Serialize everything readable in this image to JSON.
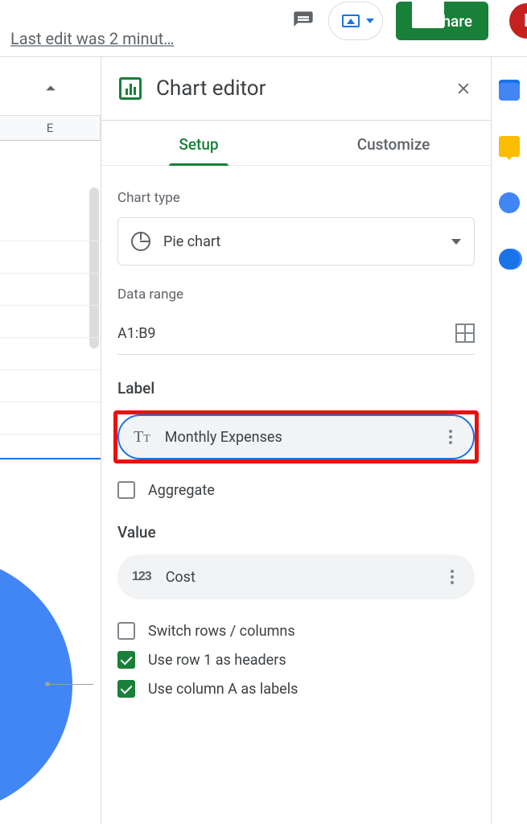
{
  "topbar": {
    "last_edit": "Last edit was 2 minut…",
    "share_label": "Share",
    "avatar_initial": "D"
  },
  "sheet": {
    "column_header": "E"
  },
  "panel": {
    "title": "Chart editor",
    "tabs": {
      "setup": "Setup",
      "customize": "Customize"
    },
    "chart_type_label": "Chart type",
    "chart_type_value": "Pie chart",
    "data_range_label": "Data range",
    "data_range_value": "A1:B9",
    "label_heading": "Label",
    "label_field": "Monthly Expenses",
    "aggregate_label": "Aggregate",
    "value_heading": "Value",
    "value_field": "Cost",
    "switch_label": "Switch rows / columns",
    "use_row1_label": "Use row 1 as headers",
    "use_colA_label": "Use column A as labels"
  }
}
